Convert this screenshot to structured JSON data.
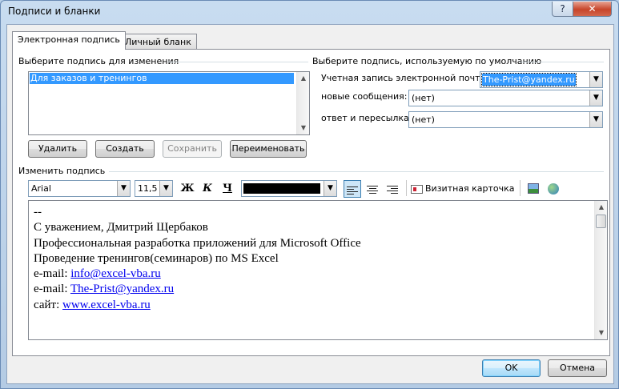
{
  "window": {
    "title": "Подписи и бланки",
    "help_glyph": "?",
    "close_glyph": "✕"
  },
  "tabs": [
    {
      "label": "Электронная подпись",
      "active": true
    },
    {
      "label": "Личный бланк",
      "active": false
    }
  ],
  "select_signature": {
    "label": "Выберите подпись для изменения",
    "items": [
      "Для заказов и тренингов"
    ],
    "selected_index": 0
  },
  "signature_buttons": {
    "delete": "Удалить",
    "create": "Создать",
    "save": "Сохранить",
    "rename": "Переименовать"
  },
  "defaults": {
    "label": "Выберите подпись, используемую по умолчанию",
    "account_label": "Учетная запись электронной почты:",
    "account_value": "The-Prist@yandex.ru",
    "new_messages_label": "новые сообщения:",
    "new_messages_value": "(нет)",
    "reply_forward_label": "ответ и пересылка:",
    "reply_forward_value": "(нет)"
  },
  "edit": {
    "label": "Изменить подпись",
    "font_name": "Arial",
    "font_size": "11,5",
    "bold_glyph": "Ж",
    "italic_glyph": "К",
    "underline_glyph": "Ч",
    "font_color": "#000000",
    "business_card_label": "Визитная карточка",
    "text_lines": [
      {
        "text": "--"
      },
      {
        "text": "С уважением, Дмитрий Щербаков"
      },
      {
        "text": "Профессиональная разработка приложений для Microsoft Office"
      },
      {
        "text": "Проведение тренингов(семинаров) по MS Excel"
      },
      {
        "prefix": "e-mail: ",
        "link": "info@excel-vba.ru"
      },
      {
        "prefix": "e-mail: ",
        "link": "The-Prist@yandex.ru"
      },
      {
        "prefix": "сайт: ",
        "link": "www.excel-vba.ru"
      }
    ]
  },
  "dialog_buttons": {
    "ok": "OK",
    "cancel": "Отмена"
  },
  "colors": {
    "selection": "#3399ff",
    "link": "#0000ee"
  }
}
